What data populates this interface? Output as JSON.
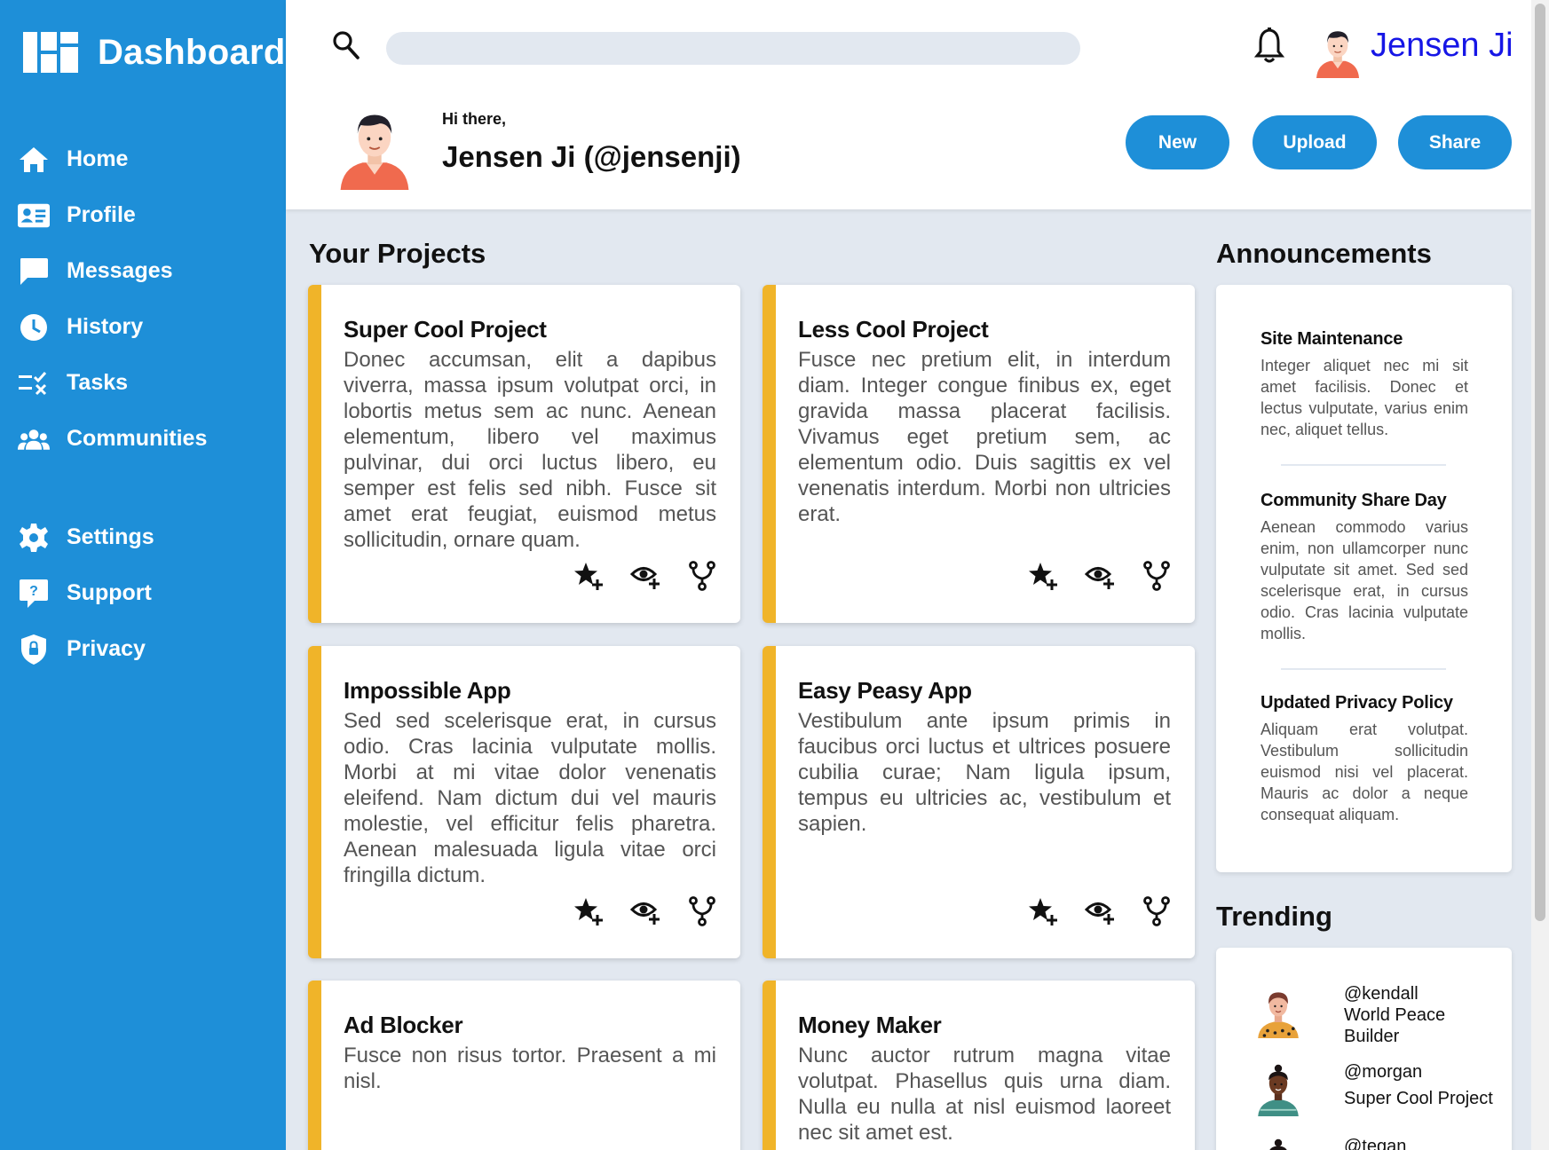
{
  "sidebar": {
    "brand": "Dashboard",
    "items": [
      {
        "label": "Home",
        "icon": "home-icon"
      },
      {
        "label": "Profile",
        "icon": "profile-card-icon"
      },
      {
        "label": "Messages",
        "icon": "message-icon"
      },
      {
        "label": "History",
        "icon": "clock-icon"
      },
      {
        "label": "Tasks",
        "icon": "tasks-icon"
      },
      {
        "label": "Communities",
        "icon": "people-icon"
      },
      {
        "label": "Settings",
        "icon": "gear-icon"
      },
      {
        "label": "Support",
        "icon": "help-icon"
      },
      {
        "label": "Privacy",
        "icon": "shield-icon"
      }
    ]
  },
  "header": {
    "search_value": "",
    "username": "Jensen Ji",
    "greeting": "Hi there,",
    "display_name": "Jensen Ji (@jensenji)",
    "buttons": {
      "new": "New",
      "upload": "Upload",
      "share": "Share"
    }
  },
  "projects": {
    "title": "Your Projects",
    "cards": [
      {
        "title": "Super Cool Project",
        "body": "Donec accumsan, elit a dapibus viverra, massa ipsum volutpat orci, in lobortis metus sem ac nunc. Aenean elementum, libero vel maximus pulvinar, dui orci luctus libero, eu semper est felis sed nibh. Fusce sit amet erat feugiat, euismod metus sollicitudin, ornare quam."
      },
      {
        "title": "Less Cool Project",
        "body": "Fusce nec pretium elit, in interdum diam. Integer congue finibus ex, eget gravida massa placerat facilisis. Vivamus eget pretium sem, ac elementum odio. Duis sagittis ex vel venenatis interdum. Morbi non ultricies erat."
      },
      {
        "title": "Impossible App",
        "body": "Sed sed scelerisque erat, in cursus odio. Cras lacinia vulputate mollis. Morbi at mi vitae dolor venenatis eleifend. Nam dictum dui vel mauris molestie, vel efficitur felis pharetra. Aenean malesuada ligula vitae orci fringilla dictum."
      },
      {
        "title": "Easy Peasy App",
        "body": "Vestibulum ante ipsum primis in faucibus orci luctus et ultrices posuere cubilia curae; Nam ligula ipsum, tempus eu ultricies ac, vestibulum et sapien."
      },
      {
        "title": "Ad Blocker",
        "body": "Fusce non risus tortor. Praesent a mi nisl."
      },
      {
        "title": "Money Maker",
        "body": "Nunc auctor rutrum magna vitae volutpat. Phasellus quis urna diam. Nulla eu nulla at nisl euismod laoreet nec sit amet est."
      }
    ]
  },
  "announcements": {
    "title": "Announcements",
    "items": [
      {
        "title": "Site Maintenance",
        "body": "Integer aliquet nec mi sit amet facilisis. Donec et lectus vulputate, varius enim nec, aliquet tellus."
      },
      {
        "title": "Community Share Day",
        "body": "Aenean commodo varius enim, non ullamcorper nunc vulputate sit amet. Sed sed scelerisque erat, in cursus odio. Cras lacinia vulputate mollis."
      },
      {
        "title": "Updated Privacy Policy",
        "body": "Aliquam erat volutpat. Vestibulum sollicitudin euismod nisi vel placerat. Mauris ac dolor a neque consequat aliquam."
      }
    ]
  },
  "trending": {
    "title": "Trending",
    "items": [
      {
        "handle": "@kendall",
        "project": "World Peace Builder"
      },
      {
        "handle": "@morgan",
        "project": "Super Cool Project"
      },
      {
        "handle": "@tegan",
        "project": ""
      }
    ]
  },
  "colors": {
    "sidebar": "#1e8fd8",
    "accent_bar": "#f0b429",
    "username": "#1616e6",
    "background": "#e2e8f0"
  }
}
